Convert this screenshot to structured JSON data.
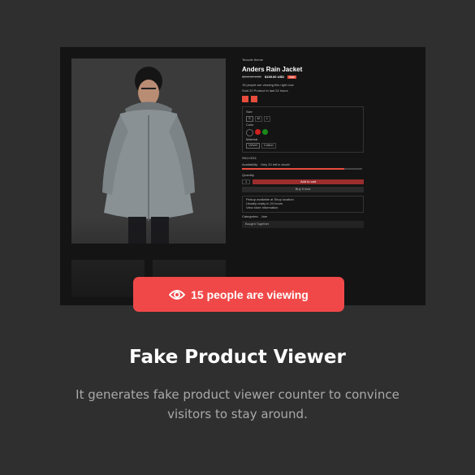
{
  "preview": {
    "breadcrumb": "Tecsofe theme",
    "product_title": "Anders Rain Jacket",
    "old_price": "$249.00 USD",
    "new_price": "$199.00 USD",
    "sale_badge": "Sale",
    "viewing_note": "15 people are viewing this right now",
    "sold_note": "Sold 20 Product in last 24 hours",
    "size_label": "Size",
    "sizes": [
      "S",
      "M",
      "L"
    ],
    "color_label": "Color",
    "color_swatches": [
      "#111111",
      "#d21f1f",
      "#1a8a1a"
    ],
    "material_label": "Material",
    "materials": [
      "Velvet",
      "Cotton"
    ],
    "sku": "SKU:0011",
    "availability_label": "Availability:",
    "availability_value": "Only 20 left in stock!",
    "availability_fraction": 0.85,
    "quantity_label": "Quantity",
    "quantity_value": "1",
    "add_to_cart_label": "Add to cart",
    "buy_now_label": "Buy it now",
    "pickup_lines": [
      "Pickup available at Shop location",
      "Usually ready in 24 hours",
      "View store information"
    ],
    "categories_label": "Categories:",
    "categories_value": "Jam",
    "bought_together_label": "Bought Together"
  },
  "viewer_badge": {
    "icon": "eye-icon",
    "text": "15 people are viewing",
    "background": "#f04848"
  },
  "feature": {
    "title": "Fake Product Viewer",
    "description": "It generates fake product viewer counter to convince visitors to stay around."
  }
}
